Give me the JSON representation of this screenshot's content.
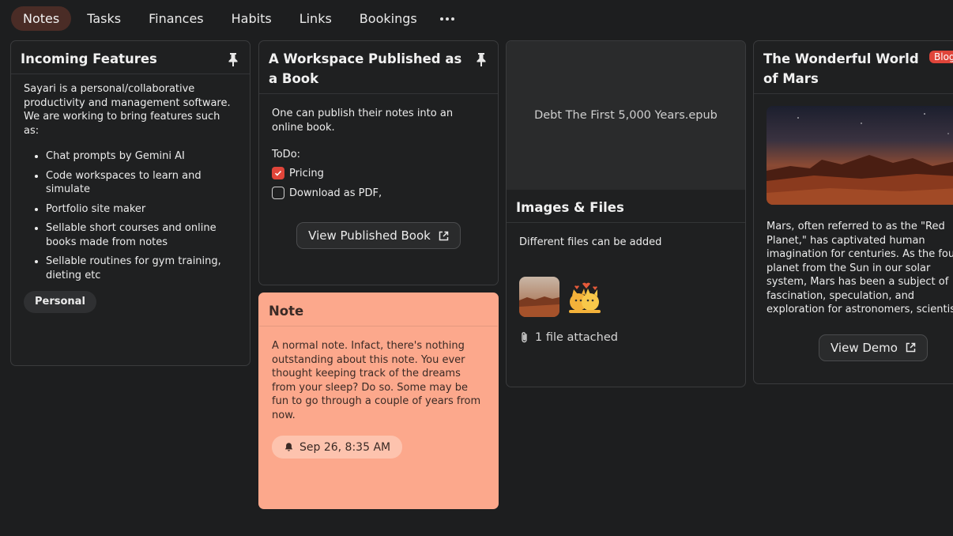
{
  "nav": {
    "tabs": [
      {
        "label": "Notes",
        "active": true
      },
      {
        "label": "Tasks"
      },
      {
        "label": "Finances"
      },
      {
        "label": "Habits"
      },
      {
        "label": "Links"
      },
      {
        "label": "Bookings"
      }
    ],
    "more_icon": "more-horizontal-icon"
  },
  "cards": {
    "features": {
      "title": "Incoming Features",
      "pinned": true,
      "intro": "Sayari is a personal/collaborative productivity and management software. We are working to bring features such as:",
      "items": [
        "Chat prompts by Gemini AI",
        "Code workspaces to learn and simulate",
        "Portfolio site maker",
        "Sellable short courses and online books made from notes",
        "Sellable routines for gym training, dieting etc"
      ],
      "tag": "Personal"
    },
    "workspace": {
      "title": "A Workspace Published as a Book",
      "pinned": true,
      "text": "One can publish their notes into an online book.",
      "todo_label": "ToDo:",
      "todos": [
        {
          "label": "Pricing",
          "checked": true
        },
        {
          "label": "Download as PDF,",
          "checked": false
        }
      ],
      "button": "View Published Book"
    },
    "note": {
      "title": "Note",
      "text": "A normal note. Infact, there's nothing outstanding about this note. You ever thought keeping track of the dreams from your sleep? Do so. Some may be fun to go through a couple of years from now.",
      "reminder": "Sep 26, 8:35 AM",
      "color": "#fca88c"
    },
    "files": {
      "preview_name": "Debt The First 5,000 Years.epub",
      "title": "Images & Files",
      "text": "Different files can be added",
      "attachment_text": "1 file attached"
    },
    "mars": {
      "title": "The Wonderful World of Mars",
      "badge": "Blog",
      "text": "Mars, often referred to as the \"Red Planet,\" has captivated human imagination for centuries. As the fourth planet from the Sun in our solar system, Mars has been a subject of fascination, speculation, and exploration for astronomers, scientists",
      "button": "View Demo"
    }
  },
  "colors": {
    "background": "#1d1e1f",
    "accent": "#e0453a",
    "active_tab": "#4a2c26"
  }
}
